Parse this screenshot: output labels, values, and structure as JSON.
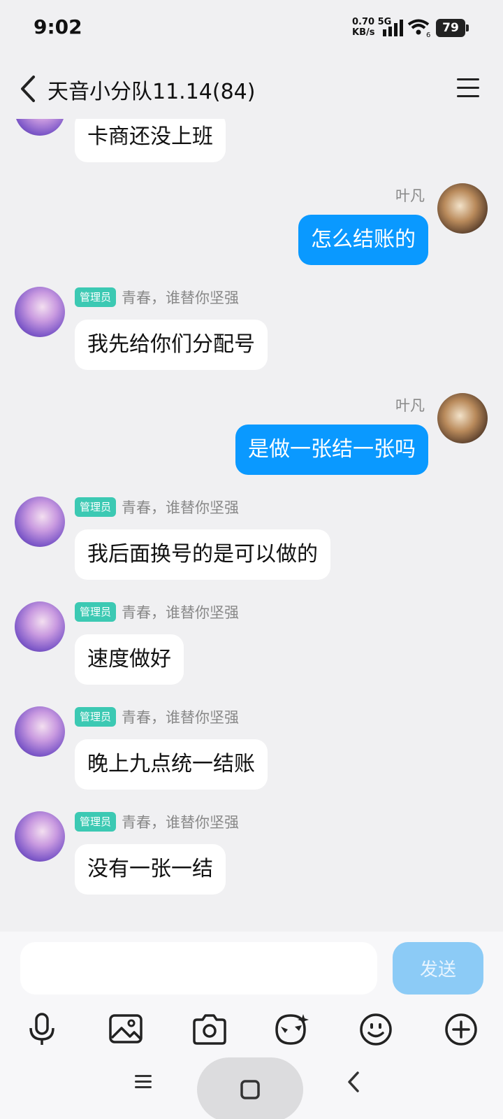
{
  "status_bar": {
    "time": "9:02",
    "net_speed": "0.70",
    "net_type": "5G",
    "net_unit": "KB/s",
    "battery": "79"
  },
  "header": {
    "title": "天音小分队11.14(84)",
    "back_icon": "chevron-left-icon",
    "menu_icon": "hamburger-menu-icon"
  },
  "messages": [
    {
      "side": "left",
      "text": "卡商还没上班"
    },
    {
      "side": "right",
      "sender": "叶凡",
      "text": "怎么结账的"
    },
    {
      "side": "left",
      "badge": "管理员",
      "sender": "青春，谁替你坚强",
      "text": "我先给你们分配号"
    },
    {
      "side": "right",
      "sender": "叶凡",
      "text": "是做一张结一张吗"
    },
    {
      "side": "left",
      "badge": "管理员",
      "sender": "青春，谁替你坚强",
      "text": "我后面换号的是可以做的"
    },
    {
      "side": "left",
      "badge": "管理员",
      "sender": "青春，谁替你坚强",
      "text": "速度做好"
    },
    {
      "side": "left",
      "badge": "管理员",
      "sender": "青春，谁替你坚强",
      "text": "晚上九点统一结账"
    },
    {
      "side": "left",
      "badge": "管理员",
      "sender": "青春，谁替你坚强",
      "text": "没有一张一结"
    }
  ],
  "input": {
    "value": "",
    "send_label": "发送"
  },
  "toolbar": [
    "microphone-icon",
    "image-icon",
    "camera-icon",
    "mask-face-icon",
    "emoji-icon",
    "plus-circle-icon"
  ],
  "colors": {
    "outgoing_bubble": "#0a99ff",
    "admin_badge": "#3cc9b3",
    "send_button": "#8ccbf6",
    "background": "#f0f0f2"
  }
}
